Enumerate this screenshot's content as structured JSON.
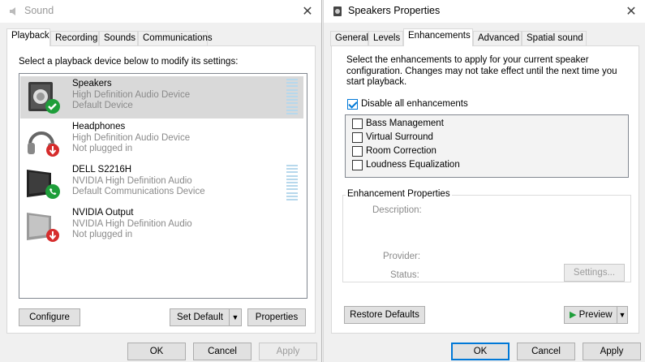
{
  "sound_window": {
    "title": "Sound",
    "tabs": [
      "Playback",
      "Recording",
      "Sounds",
      "Communications"
    ],
    "instruction": "Select a playback device below to modify its settings:",
    "devices": [
      {
        "name": "Speakers",
        "line1": "High Definition Audio Device",
        "line2": "Default Device"
      },
      {
        "name": "Headphones",
        "line1": "High Definition Audio Device",
        "line2": "Not plugged in"
      },
      {
        "name": "DELL S2216H",
        "line1": "NVIDIA High Definition Audio",
        "line2": "Default Communications Device"
      },
      {
        "name": "NVIDIA Output",
        "line1": "NVIDIA High Definition Audio",
        "line2": "Not plugged in"
      }
    ],
    "configure_label": "Configure",
    "set_default_label": "Set Default",
    "properties_label": "Properties",
    "ok_label": "OK",
    "cancel_label": "Cancel",
    "apply_label": "Apply"
  },
  "props_window": {
    "title": "Speakers Properties",
    "tabs": [
      "General",
      "Levels",
      "Enhancements",
      "Advanced",
      "Spatial sound"
    ],
    "description": "Select the enhancements to apply for your current speaker configuration. Changes may not take effect until the next time you start playback.",
    "disable_all_label": "Disable all enhancements",
    "disable_all_checked": true,
    "enhancements": [
      {
        "label": "Bass Management",
        "checked": false
      },
      {
        "label": "Virtual Surround",
        "checked": false
      },
      {
        "label": "Room Correction",
        "checked": false
      },
      {
        "label": "Loudness Equalization",
        "checked": false
      }
    ],
    "group_title": "Enhancement Properties",
    "description_label": "Description:",
    "provider_label": "Provider:",
    "status_label": "Status:",
    "settings_label": "Settings...",
    "restore_label": "Restore Defaults",
    "preview_label": "Preview",
    "ok_label": "OK",
    "cancel_label": "Cancel",
    "apply_label": "Apply"
  },
  "colors": {
    "accent": "#0078d7",
    "check_green": "#1e9e3a",
    "unplugged_red": "#d62c2c",
    "meter_blue": "#b7d8ec"
  },
  "icons": [
    "speaker-icon",
    "headphones-icon",
    "monitor-icon",
    "close-icon",
    "check-icon",
    "phone-icon",
    "down-arrow-icon",
    "play-icon",
    "dropdown-arrow-icon"
  ]
}
